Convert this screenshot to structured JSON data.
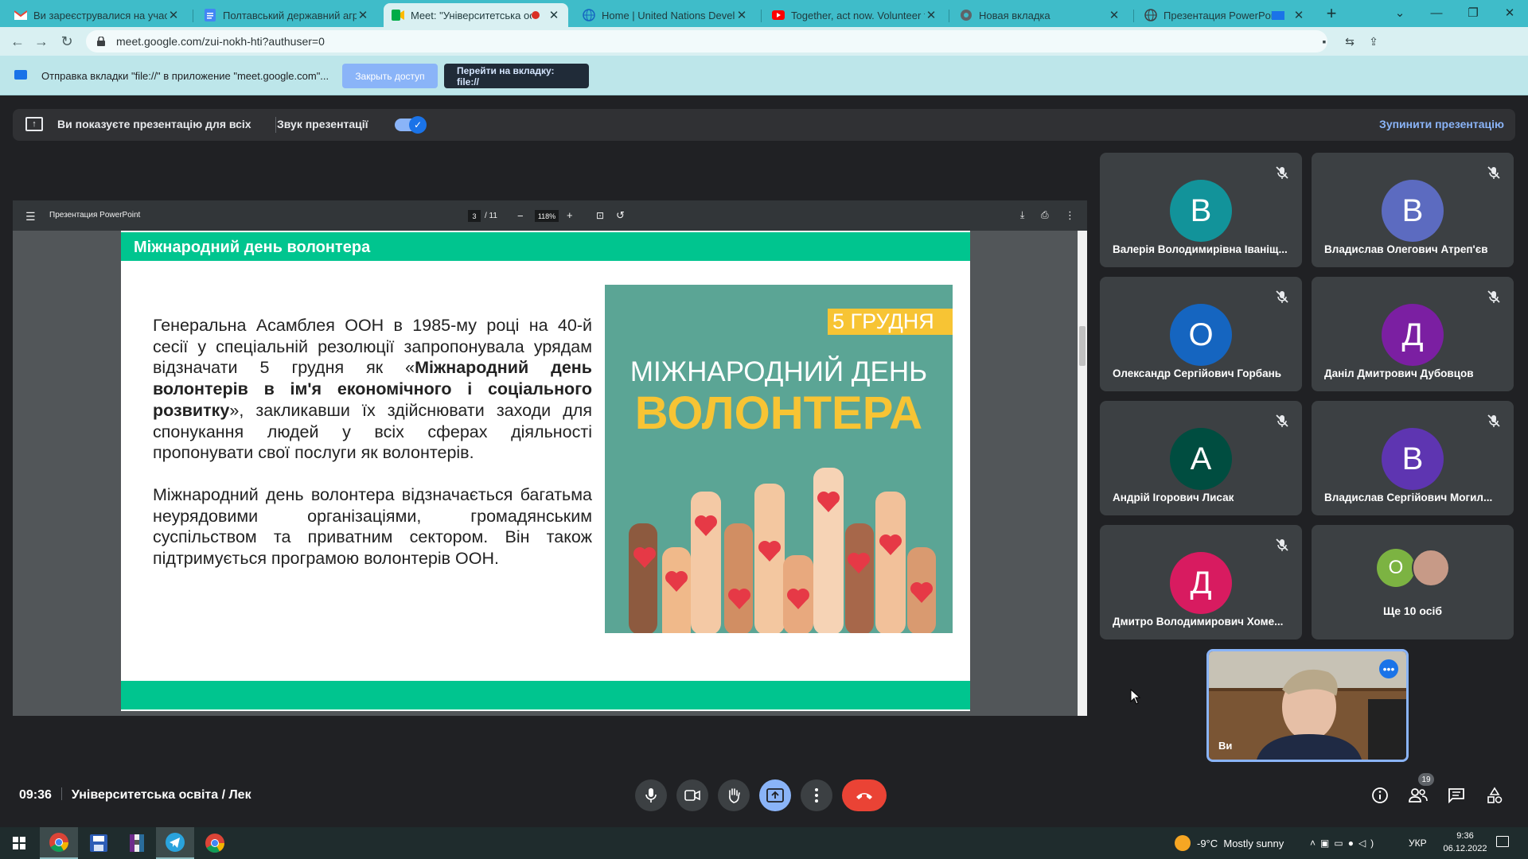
{
  "browser": {
    "tabs": [
      {
        "title": "Ви зареєструвалися на участь у"
      },
      {
        "title": "Полтавський державний аграр"
      },
      {
        "title": "Meet: \"Університетська осв"
      },
      {
        "title": "Home | United Nations Develop"
      },
      {
        "title": "Together, act now. Volunteer for"
      },
      {
        "title": "Новая вкладка"
      },
      {
        "title": "Презентация PowerPoint"
      }
    ],
    "url": "meet.google.com/zui-nokh-hti?authuser=0",
    "infobar": {
      "message": "Отправка вкладки \"file://\" в приложение \"meet.google.com\"...",
      "close_button": "Закрыть доступ",
      "goto_button": "Перейти на вкладку: file://"
    }
  },
  "meet": {
    "presenting_text": "Ви показуєте презентацію для всіх",
    "audio_label": "Звук презентації",
    "stop_label": "Зупинити презентацію",
    "time": "09:36",
    "meeting_title": "Університетська освіта / Лек",
    "people_count": "19",
    "self_label": "Ви",
    "more_people": "Ще 10 осіб",
    "more_people_initial": "О",
    "participants": [
      {
        "initial": "В",
        "name": "Валерія Володимирівна Іваніщ...",
        "color": "#12939a"
      },
      {
        "initial": "В",
        "name": "Владислав Олегович Атреп'єв",
        "color": "#5c6bc0"
      },
      {
        "initial": "О",
        "name": "Олександр Сергійович Горбань",
        "color": "#1565c0"
      },
      {
        "initial": "Д",
        "name": "Даніл Дмитрович Дубовцов",
        "color": "#7b1fa2"
      },
      {
        "initial": "А",
        "name": "Андрій Ігорович Лисак",
        "color": "#004d40"
      },
      {
        "initial": "В",
        "name": "Владислав Сергійович Могил...",
        "color": "#5e35b1"
      },
      {
        "initial": "Д",
        "name": "Дмитро Володимирович Хоме...",
        "color": "#d81b60"
      }
    ]
  },
  "pdf": {
    "title": "Презентация PowerPoint",
    "page": "3",
    "total": "/ 11",
    "zoom": "118%"
  },
  "slide": {
    "header": "Міжнародний день волонтера",
    "p1_a": "Генеральна Асамблея ООН в 1985-му році на 40-й сесії у спеціальній резолюції запропонувала урядам відзначати 5 грудня як «",
    "p1_bold": "Міжнародний день волонтерів в ім'я економічного і соціального розвитку",
    "p1_b": "», закликавши їх здійснювати заходи для спонукання людей у всіх сферах діяльності пропонувати свої послуги як волонтерів.",
    "p2": "Міжнародний день волонтера відзначається багатьма неурядовими організаціями, громадянським суспільством та приватним сектором. Він також підтримується програмою волонтерів ООН.",
    "poster_date": "5 ГРУДНЯ",
    "poster_line1": "МІЖНАРОДНИЙ ДЕНЬ",
    "poster_line2": "ВОЛОНТЕРА"
  },
  "taskbar": {
    "weather": "-9°C  Mostly sunny",
    "lang": "УКР",
    "time": "9:36",
    "date": "06.12.2022"
  }
}
